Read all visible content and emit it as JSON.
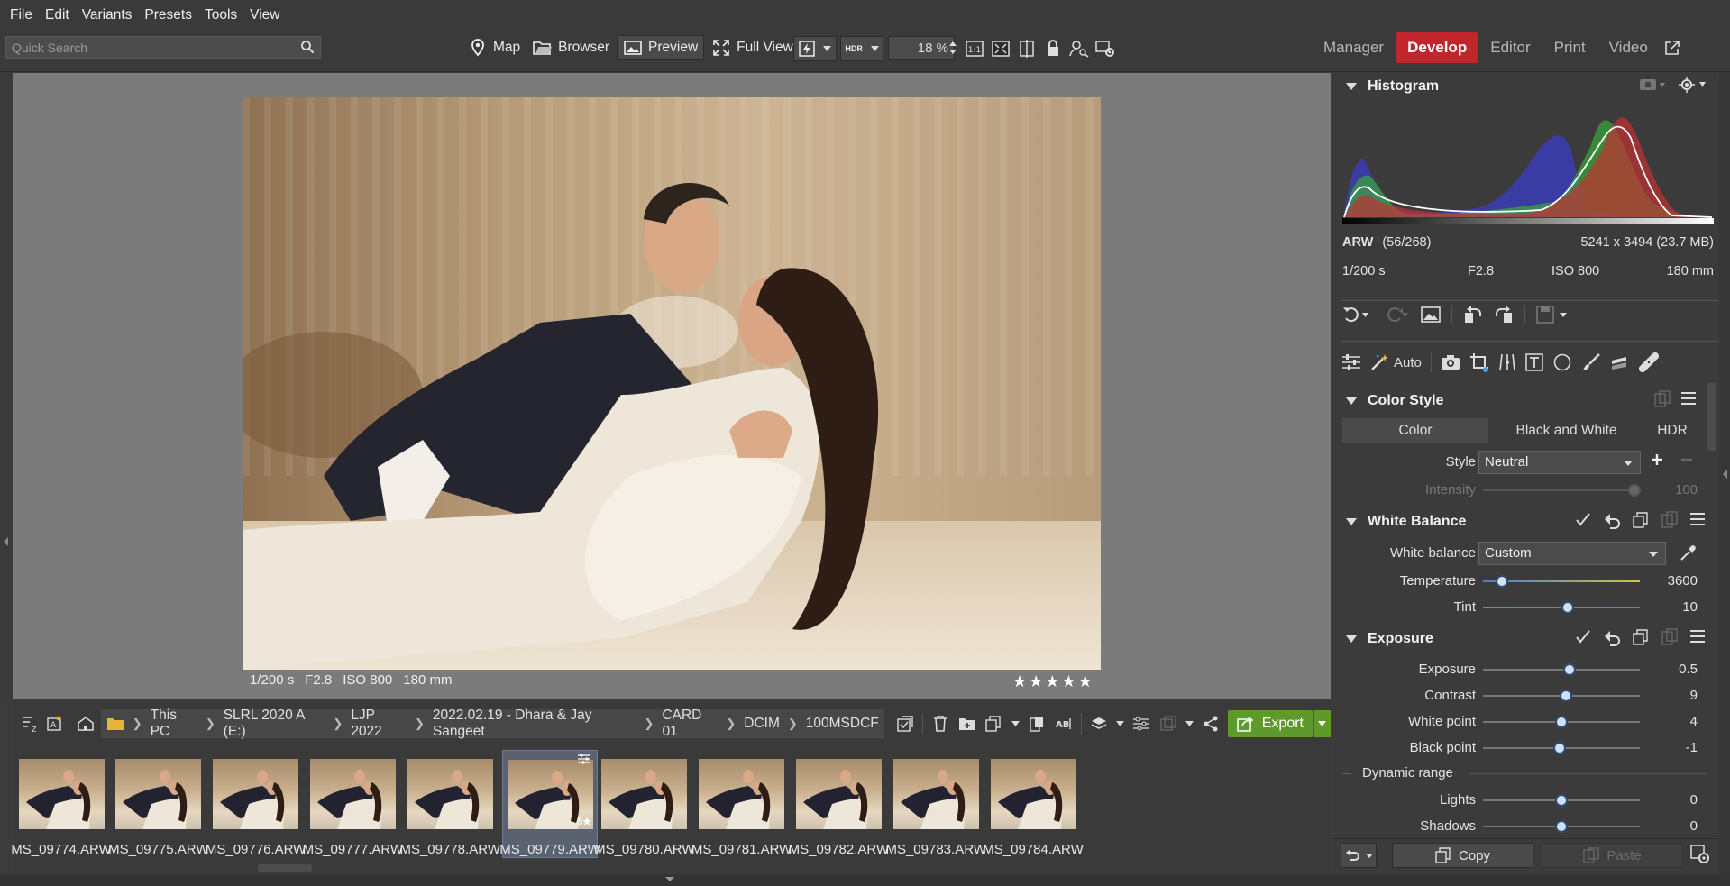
{
  "menu": [
    "File",
    "Edit",
    "Variants",
    "Presets",
    "Tools",
    "View"
  ],
  "search": {
    "placeholder": "Quick Search"
  },
  "toolbar": {
    "map": "Map",
    "browser": "Browser",
    "preview": "Preview",
    "fullview": "Full View",
    "hdr": "HDR",
    "zoom": "18 %"
  },
  "modes": [
    {
      "label": "Manager",
      "active": false
    },
    {
      "label": "Develop",
      "active": true
    },
    {
      "label": "Editor",
      "active": false
    },
    {
      "label": "Print",
      "active": false
    },
    {
      "label": "Video",
      "active": false
    }
  ],
  "photo_info": {
    "shutter": "1/200 s",
    "aperture": "F2.8",
    "iso": "ISO 800",
    "focal": "180 mm",
    "stars": 5
  },
  "path": [
    "This PC",
    "SLRL 2020 A (E:)",
    "LJP 2022",
    "2022.02.19 - Dhara & Jay Sangeet",
    "CARD 01",
    "DCIM",
    "100MSDCF"
  ],
  "export_label": "Export",
  "filmstrip": [
    {
      "name": "MS_09774.ARW",
      "selected": false
    },
    {
      "name": "MS_09775.ARW",
      "selected": false
    },
    {
      "name": "MS_09776.ARW",
      "selected": false
    },
    {
      "name": "MS_09777.ARW",
      "selected": false
    },
    {
      "name": "MS_09778.ARW",
      "selected": false
    },
    {
      "name": "MS_09779.ARW",
      "selected": true,
      "rating_badge": "5★"
    },
    {
      "name": "MS_09780.ARW",
      "selected": false
    },
    {
      "name": "MS_09781.ARW",
      "selected": false
    },
    {
      "name": "MS_09782.ARW",
      "selected": false
    },
    {
      "name": "MS_09783.ARW",
      "selected": false
    },
    {
      "name": "MS_09784.ARW",
      "selected": false
    }
  ],
  "histogram": {
    "title": "Histogram",
    "format": "ARW",
    "index": "(56/268)",
    "dimensions": "5241 x 3494 (23.7 MB)",
    "shutter": "1/200 s",
    "aperture": "F2.8",
    "iso": "ISO 800",
    "focal": "180 mm"
  },
  "tools": {
    "auto": "Auto"
  },
  "color_style": {
    "title": "Color Style",
    "tabs": [
      {
        "label": "Color",
        "active": true
      },
      {
        "label": "Black and White",
        "active": false
      },
      {
        "label": "HDR",
        "active": false
      }
    ],
    "style_label": "Style",
    "style_value": "Neutral",
    "intensity_label": "Intensity",
    "intensity_value": "100"
  },
  "white_balance": {
    "title": "White Balance",
    "wb_label": "White balance",
    "wb_value": "Custom",
    "temperature_label": "Temperature",
    "temperature_value": "3600",
    "temperature_pos": 0.12,
    "tint_label": "Tint",
    "tint_value": "10",
    "tint_pos": 0.54
  },
  "exposure": {
    "title": "Exposure",
    "rows": [
      {
        "label": "Exposure",
        "value": "0.5",
        "pos": 0.55
      },
      {
        "label": "Contrast",
        "value": "9",
        "pos": 0.53
      },
      {
        "label": "White point",
        "value": "4",
        "pos": 0.5
      },
      {
        "label": "Black point",
        "value": "-1",
        "pos": 0.49
      }
    ],
    "dynamic_range": "Dynamic range",
    "dr_rows": [
      {
        "label": "Lights",
        "value": "0",
        "pos": 0.5
      },
      {
        "label": "Shadows",
        "value": "0",
        "pos": 0.5
      }
    ]
  },
  "bottom": {
    "copy": "Copy",
    "paste": "Paste"
  },
  "colors": {
    "accent_red": "#c0262c",
    "export_green": "#5e9a2b",
    "slider_knob": "#cfe1f5"
  }
}
